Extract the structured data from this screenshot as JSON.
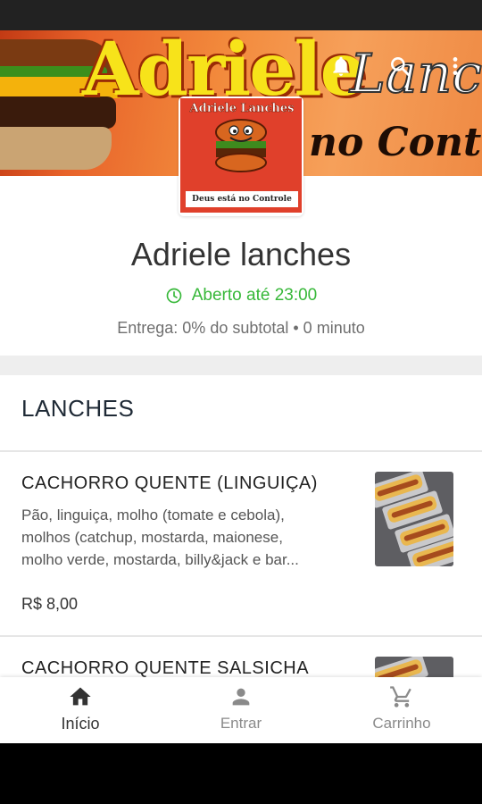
{
  "banner": {
    "brand_line1": "Adriele",
    "brand_line2": "Lanc",
    "brand_line3": "no Contro"
  },
  "header_icons": [
    "bell-icon",
    "search-icon",
    "more-vertical-icon"
  ],
  "logo": {
    "arc_text": "Adriele Lanches",
    "tagline": "Deus está no Controle"
  },
  "store": {
    "name": "Adriele lanches",
    "open_status": "Aberto até 23:00",
    "delivery": "Entrega: 0% do subtotal • 0 minuto"
  },
  "section": {
    "title": "LANCHES"
  },
  "items": [
    {
      "name": "CACHORRO QUENTE (LINGUIÇA)",
      "desc_lines": [
        "Pão, linguiça, molho (tomate e cebola),",
        "molhos (catchup, mostarda, maionese,",
        "molho verde, mostarda, billy&jack e bar..."
      ],
      "price": "R$ 8,00"
    },
    {
      "name": "CACHORRO QUENTE SALSICHA"
    }
  ],
  "nav": [
    {
      "label": "Início",
      "icon": "home-icon",
      "active": true
    },
    {
      "label": "Entrar",
      "icon": "person-icon",
      "active": false
    },
    {
      "label": "Carrinho",
      "icon": "cart-icon",
      "active": false
    }
  ],
  "colors": {
    "open_green": "#37b839",
    "title_dark": "#1f2a36",
    "banner_orange": "#f28a3c"
  }
}
